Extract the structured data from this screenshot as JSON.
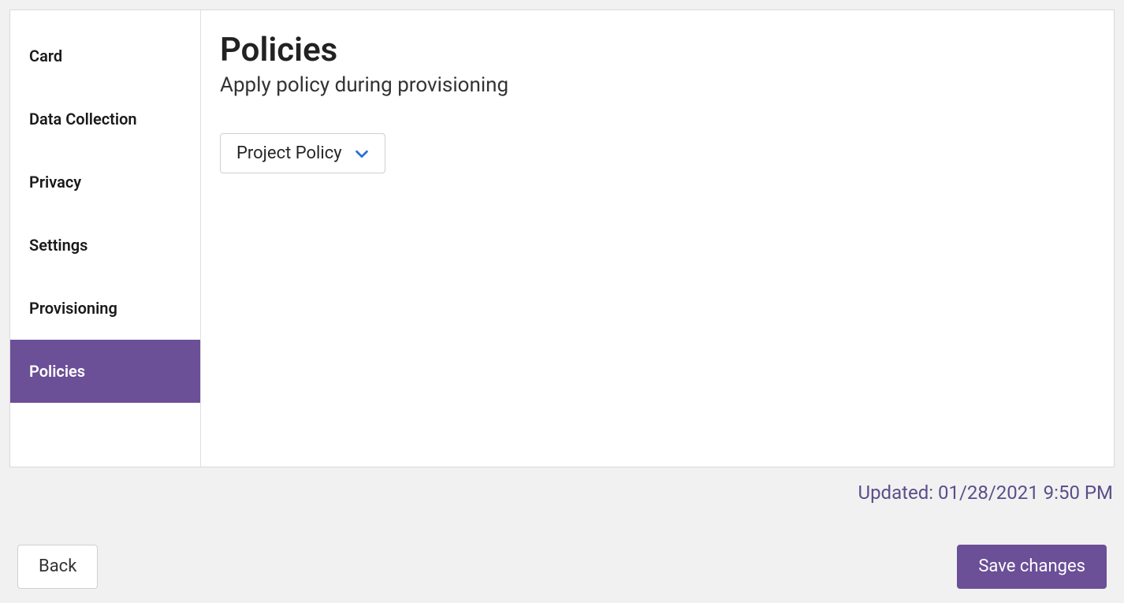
{
  "sidebar": {
    "items": [
      {
        "label": "Card",
        "active": false
      },
      {
        "label": "Data Collection",
        "active": false
      },
      {
        "label": "Privacy",
        "active": false
      },
      {
        "label": "Settings",
        "active": false
      },
      {
        "label": "Provisioning",
        "active": false
      },
      {
        "label": "Policies",
        "active": true
      }
    ]
  },
  "main": {
    "title": "Policies",
    "subtitle": "Apply policy during provisioning",
    "dropdown": {
      "selected": "Project Policy"
    }
  },
  "status": {
    "updated_label": "Updated: 01/28/2021 9:50 PM"
  },
  "footer": {
    "back_label": "Back",
    "save_label": "Save changes"
  },
  "colors": {
    "accent": "#6b4f97",
    "dropdown_chevron": "#2a6fd6"
  }
}
